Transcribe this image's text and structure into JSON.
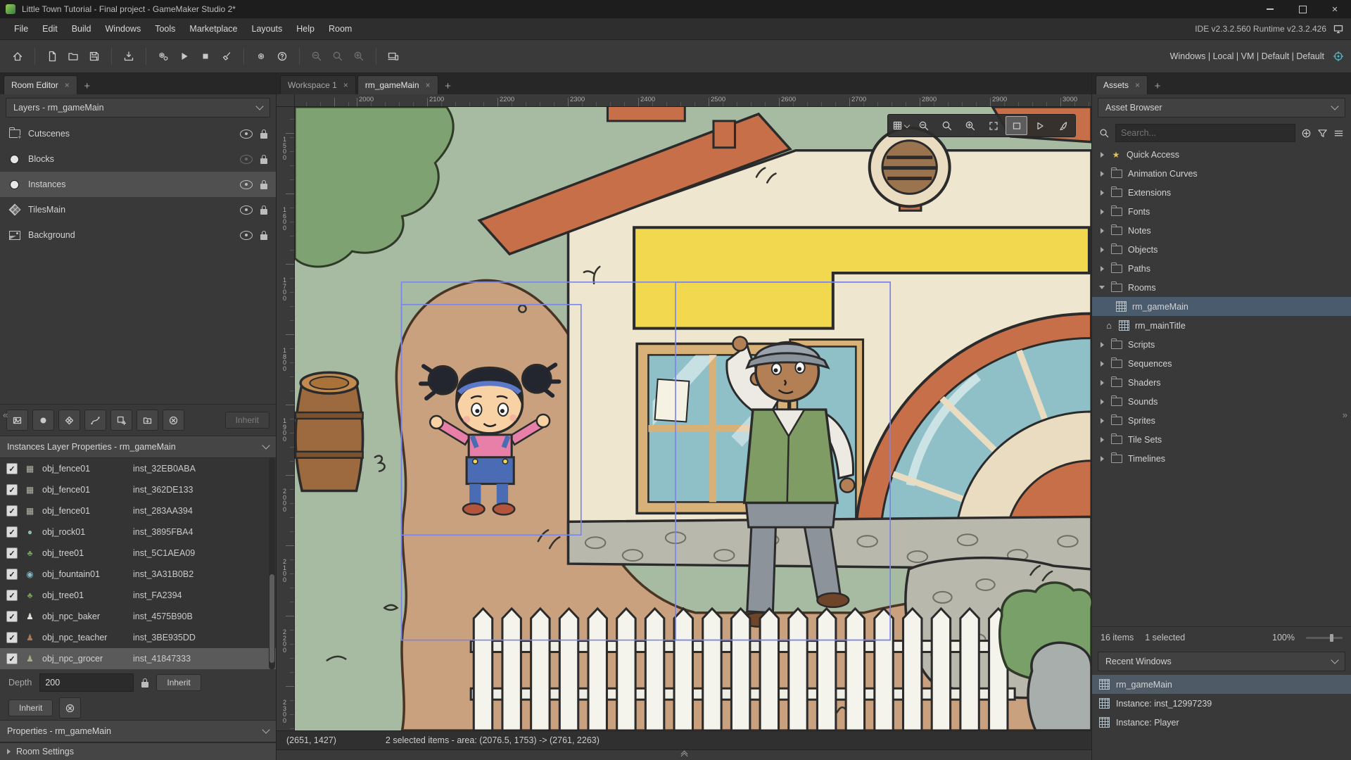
{
  "window": {
    "title": "Little Town Tutorial - Final project - GameMaker Studio 2*",
    "version_info": "IDE v2.3.2.560 Runtime v2.3.2.426",
    "build_targets": "Windows | Local | VM | Default | Default"
  },
  "menubar": {
    "items": [
      "File",
      "Edit",
      "Build",
      "Windows",
      "Tools",
      "Marketplace",
      "Layouts",
      "Help",
      "Room"
    ]
  },
  "left_panel": {
    "tab_label": "Room Editor",
    "layers_dropdown": "Layers - rm_gameMain",
    "layers": [
      {
        "name": "Cutscenes"
      },
      {
        "name": "Blocks"
      },
      {
        "name": "Instances"
      },
      {
        "name": "TilesMain"
      },
      {
        "name": "Background"
      }
    ],
    "inherit_label": "Inherit",
    "instances_header": "Instances Layer Properties - rm_gameMain",
    "instances": [
      {
        "object": "obj_fence01",
        "id": "inst_32EB0ABA"
      },
      {
        "object": "obj_fence01",
        "id": "inst_362DE133"
      },
      {
        "object": "obj_fence01",
        "id": "inst_283AA394"
      },
      {
        "object": "obj_rock01",
        "id": "inst_3895FBA4"
      },
      {
        "object": "obj_tree01",
        "id": "inst_5C1AEA09"
      },
      {
        "object": "obj_fountain01",
        "id": "inst_3A31B0B2"
      },
      {
        "object": "obj_tree01",
        "id": "inst_FA2394"
      },
      {
        "object": "obj_npc_baker",
        "id": "inst_4575B90B"
      },
      {
        "object": "obj_npc_teacher",
        "id": "inst_3BE935DD"
      },
      {
        "object": "obj_npc_grocer",
        "id": "inst_41847333"
      }
    ],
    "depth_label": "Depth",
    "depth_value": "200",
    "properties_header": "Properties - rm_gameMain",
    "room_settings_label": "Room Settings"
  },
  "workspace": {
    "tab1": "Workspace 1",
    "tab2": "rm_gameMain",
    "ruler_h": [
      "2000",
      "2100",
      "2200",
      "2300",
      "2400",
      "2500",
      "2600",
      "2700",
      "2800",
      "2900",
      "3000"
    ],
    "ruler_v": [
      "1500",
      "1600",
      "1700",
      "1800",
      "1900",
      "2000",
      "2100",
      "2200",
      "2300"
    ],
    "status_coords": "(2651, 1427)",
    "status_selection": "2 selected items - area: (2076.5, 1753) -> (2761, 2263)"
  },
  "right_panel": {
    "tab_label": "Assets",
    "browser_dropdown": "Asset Browser",
    "search_placeholder": "Search...",
    "tree": [
      {
        "label": "Quick Access"
      },
      {
        "label": "Animation Curves"
      },
      {
        "label": "Extensions"
      },
      {
        "label": "Fonts"
      },
      {
        "label": "Notes"
      },
      {
        "label": "Objects"
      },
      {
        "label": "Paths"
      },
      {
        "label": "Rooms"
      },
      {
        "label": "rm_gameMain"
      },
      {
        "label": "rm_mainTitle"
      },
      {
        "label": "Scripts"
      },
      {
        "label": "Sequences"
      },
      {
        "label": "Shaders"
      },
      {
        "label": "Sounds"
      },
      {
        "label": "Sprites"
      },
      {
        "label": "Tile Sets"
      },
      {
        "label": "Timelines"
      }
    ],
    "footer_items": "16 items",
    "footer_selected": "1 selected",
    "footer_zoom": "100%",
    "recent_dropdown": "Recent Windows",
    "recent": [
      {
        "label": "rm_gameMain"
      },
      {
        "label": "Instance: inst_12997239"
      },
      {
        "label": "Instance: Player"
      }
    ]
  }
}
